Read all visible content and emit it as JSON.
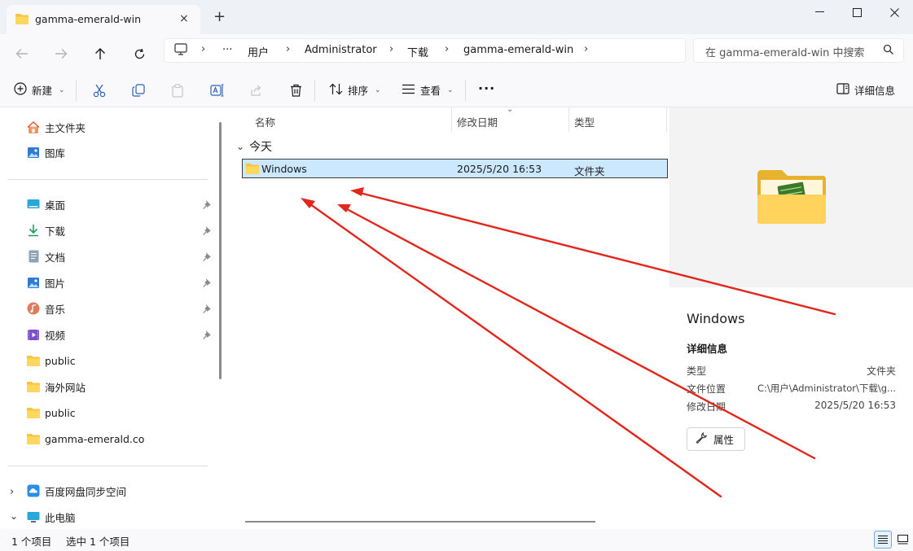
{
  "tab": {
    "title": "gamma-emerald-win",
    "close_icon": "×",
    "new_tab_icon": "+"
  },
  "window": {
    "minimize": "—",
    "maximize": "☐",
    "close": "✕"
  },
  "breadcrumb": {
    "ellipsis": "···",
    "items": [
      "用户",
      "Administrator",
      "下载",
      "gamma-emerald-win"
    ]
  },
  "search": {
    "placeholder": "在 gamma-emerald-win 中搜索"
  },
  "toolbar": {
    "new_label": "新建",
    "sort_label": "排序",
    "view_label": "查看",
    "more_label": "···",
    "details_label": "详细信息"
  },
  "sidebar": {
    "top_items": [
      {
        "label": "主文件夹",
        "icon": "home-icon"
      },
      {
        "label": "图库",
        "icon": "gallery-icon"
      }
    ],
    "pinned_items": [
      {
        "label": "桌面",
        "icon": "desktop-icon"
      },
      {
        "label": "下载",
        "icon": "download-icon"
      },
      {
        "label": "文档",
        "icon": "documents-icon"
      },
      {
        "label": "图片",
        "icon": "pictures-icon"
      },
      {
        "label": "音乐",
        "icon": "music-icon"
      },
      {
        "label": "视频",
        "icon": "videos-icon"
      }
    ],
    "folders": [
      "public",
      "海外网站",
      "public",
      "gamma-emerald.co"
    ],
    "bottom_items": [
      {
        "label": "百度网盘同步空间",
        "icon": "baidu-cloud-icon",
        "expand": "›"
      },
      {
        "label": "此电脑",
        "icon": "this-pc-icon",
        "expand": "⌄"
      }
    ]
  },
  "columns": {
    "name": "名称",
    "modified": "修改日期",
    "type": "类型"
  },
  "group": {
    "label": "今天",
    "chevron": "⌄"
  },
  "files": [
    {
      "name": "Windows",
      "modified": "2025/5/20 16:53",
      "type": "文件夹"
    }
  ],
  "details": {
    "name": "Windows",
    "section_title": "详细信息",
    "type_key": "类型",
    "type_value": "文件夹",
    "location_key": "文件位置",
    "location_value": "C:\\用户\\Administrator\\下载\\g...",
    "modified_key": "修改日期",
    "modified_value": "2025/5/20 16:53",
    "properties_label": "属性"
  },
  "status": {
    "item_count": "1 个项目",
    "selected": "选中 1 个项目"
  },
  "colors": {
    "folder_yellow": "#f5c542",
    "selection": "#cce8ff",
    "annotation_red": "#e3261c",
    "accent_blue": "#0067c0"
  }
}
